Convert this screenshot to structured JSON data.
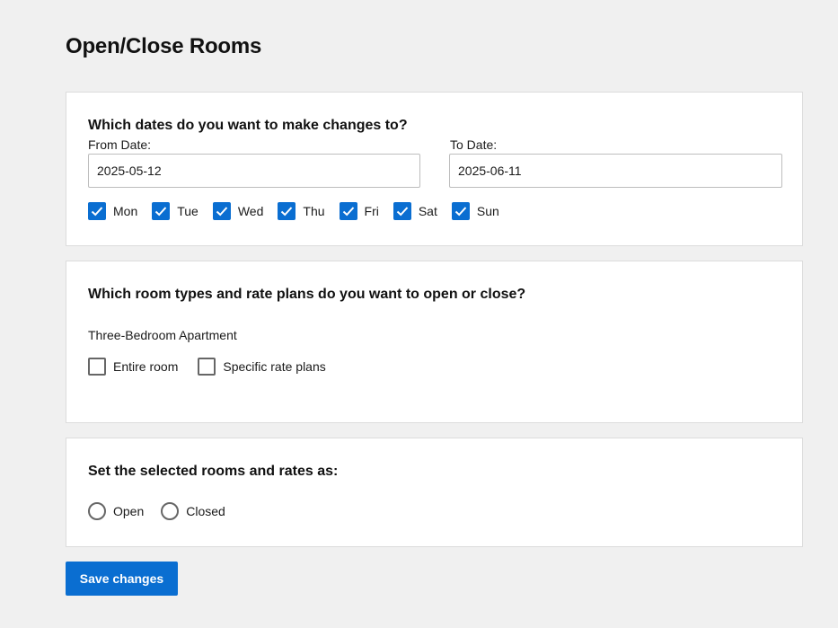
{
  "page": {
    "title": "Open/Close Rooms"
  },
  "dates_section": {
    "title": "Which dates do you want to make changes to?",
    "from_label": "From Date:",
    "from_value": "2025-05-12",
    "to_label": "To Date:",
    "to_value": "2025-06-11",
    "days": [
      {
        "label": "Mon",
        "checked": true
      },
      {
        "label": "Tue",
        "checked": true
      },
      {
        "label": "Wed",
        "checked": true
      },
      {
        "label": "Thu",
        "checked": true
      },
      {
        "label": "Fri",
        "checked": true
      },
      {
        "label": "Sat",
        "checked": true
      },
      {
        "label": "Sun",
        "checked": true
      }
    ]
  },
  "rooms_section": {
    "title": "Which room types and rate plans do you want to open or close?",
    "room_name": "Three-Bedroom Apartment",
    "options": [
      {
        "label": "Entire room",
        "checked": false
      },
      {
        "label": "Specific rate plans",
        "checked": false
      }
    ]
  },
  "status_section": {
    "title": "Set the selected rooms and rates as:",
    "options": [
      {
        "label": "Open",
        "selected": false
      },
      {
        "label": "Closed",
        "selected": false
      }
    ]
  },
  "actions": {
    "save_label": "Save changes"
  },
  "colors": {
    "accent": "#0a6ed1",
    "background": "#f0f0f0",
    "card": "#ffffff"
  }
}
